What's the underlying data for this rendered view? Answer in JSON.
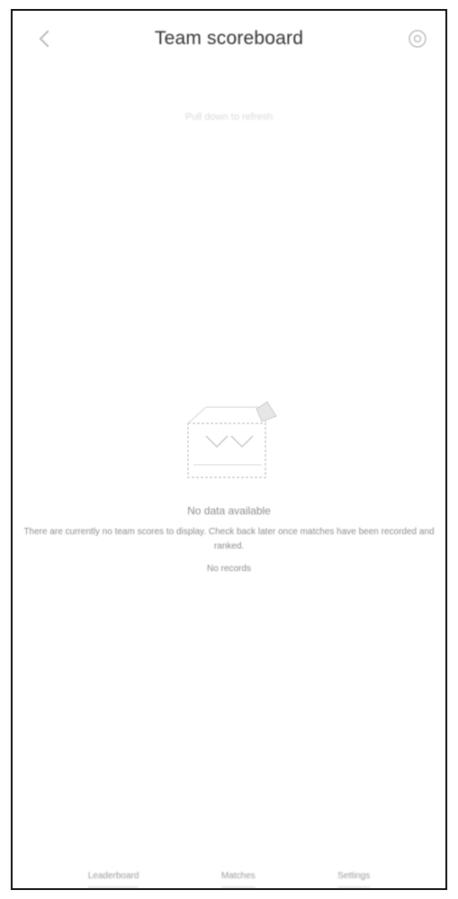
{
  "header": {
    "title": "Team scoreboard",
    "back_icon": "back-arrow-icon",
    "settings_icon": "settings-icon"
  },
  "hint": "Pull down to refresh",
  "empty_state": {
    "illustration_icon": "empty-box-icon",
    "title": "No data available",
    "description": "There are currently no team scores to display. Check back later once matches have been recorded and ranked.",
    "footnote": "No records"
  },
  "bottom_nav": [
    {
      "label": "Leaderboard"
    },
    {
      "label": "Matches"
    },
    {
      "label": "Settings"
    }
  ],
  "colors": {
    "border": "#111111",
    "text": "#333333",
    "muted": "#8c8c8c"
  }
}
